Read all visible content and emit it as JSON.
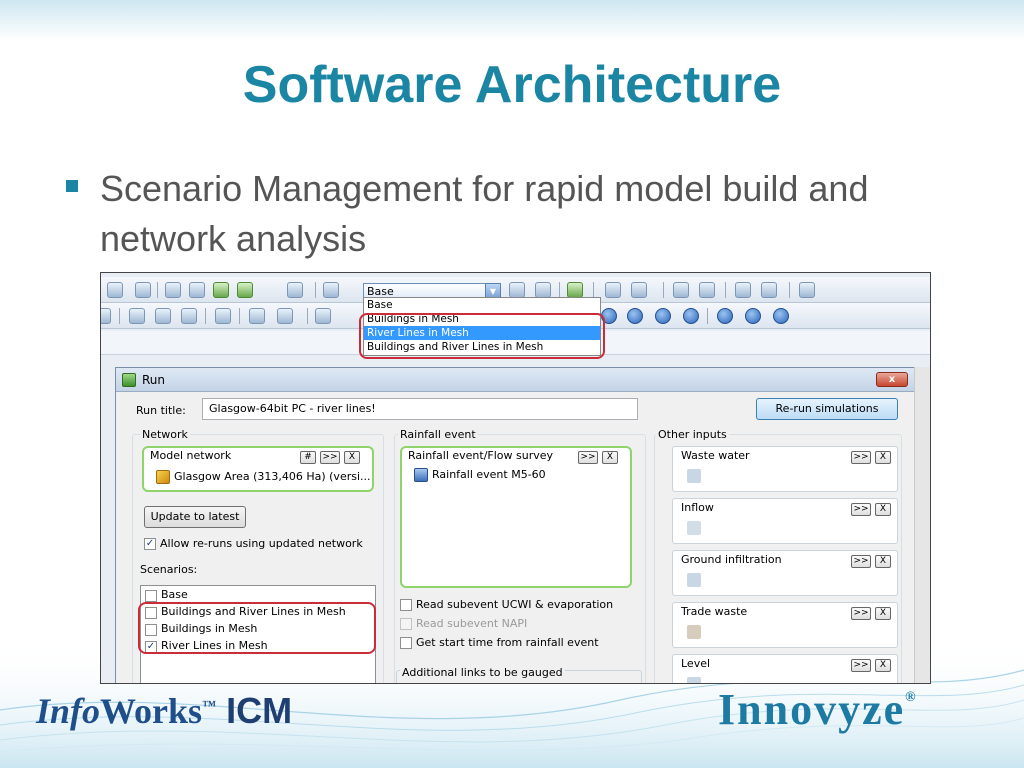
{
  "slide": {
    "title": "Software Architecture",
    "bullet": "Scenario Management for rapid model build and network analysis"
  },
  "toolbar": {
    "scenario_combo_value": "Base",
    "scenario_options": [
      "Base",
      "Buildings in Mesh",
      "River Lines in Mesh",
      "Buildings and River Lines in Mesh"
    ],
    "selected_option": "River Lines in Mesh"
  },
  "run_dialog": {
    "title": "Run",
    "close_label": "x",
    "run_title_label": "Run title:",
    "run_title_value": "Glasgow-64bit PC - river lines!",
    "rerun_button": "Re-run simulations",
    "network": {
      "group_label": "Network",
      "model_network_label": "Model network",
      "model_network_value": "Glasgow Area (313,406 Ha) (versi...",
      "btn_hash": "#",
      "btn_more": ">>",
      "btn_x": "X",
      "update_button": "Update to latest",
      "allow_reruns_label": "Allow re-runs using updated network",
      "scenarios_label": "Scenarios:",
      "scenarios": [
        {
          "label": "Base",
          "checked": false
        },
        {
          "label": "Buildings and River Lines in Mesh",
          "checked": false
        },
        {
          "label": "Buildings in Mesh",
          "checked": false
        },
        {
          "label": "River Lines in Mesh",
          "checked": true
        }
      ]
    },
    "rainfall": {
      "group_label": "Rainfall event",
      "survey_label": "Rainfall event/Flow survey",
      "survey_value": "Rainfall event M5-60",
      "btn_more": ">>",
      "btn_x": "X",
      "read_ucwi": "Read subevent UCWI & evaporation",
      "read_napi": "Read subevent NAPI",
      "get_start_time": "Get start time from rainfall event",
      "additional_links": "Additional links to be gauged"
    },
    "other_inputs": {
      "group_label": "Other inputs",
      "btn_more": ">>",
      "btn_x": "X",
      "items": [
        "Waste water",
        "Inflow",
        "Ground infiltration",
        "Trade waste",
        "Level"
      ]
    }
  },
  "logos": {
    "infoworks_info": "Info",
    "infoworks_works": "Works",
    "infoworks_tm": "™",
    "infoworks_icm": " ICM",
    "innovyze": "Innovyze",
    "innovyze_reg": "®"
  },
  "colors": {
    "title_teal": "#1b86a4",
    "bullet_gray": "#555555",
    "highlight_red": "#cc2b3a",
    "group_green": "#8ed46b",
    "selection_blue": "#3399ff"
  },
  "icons": [
    "run-icon",
    "network-icon",
    "rainfall-icon",
    "waste-water-icon",
    "inflow-icon",
    "ground-infiltration-icon",
    "trade-waste-icon",
    "level-icon"
  ]
}
